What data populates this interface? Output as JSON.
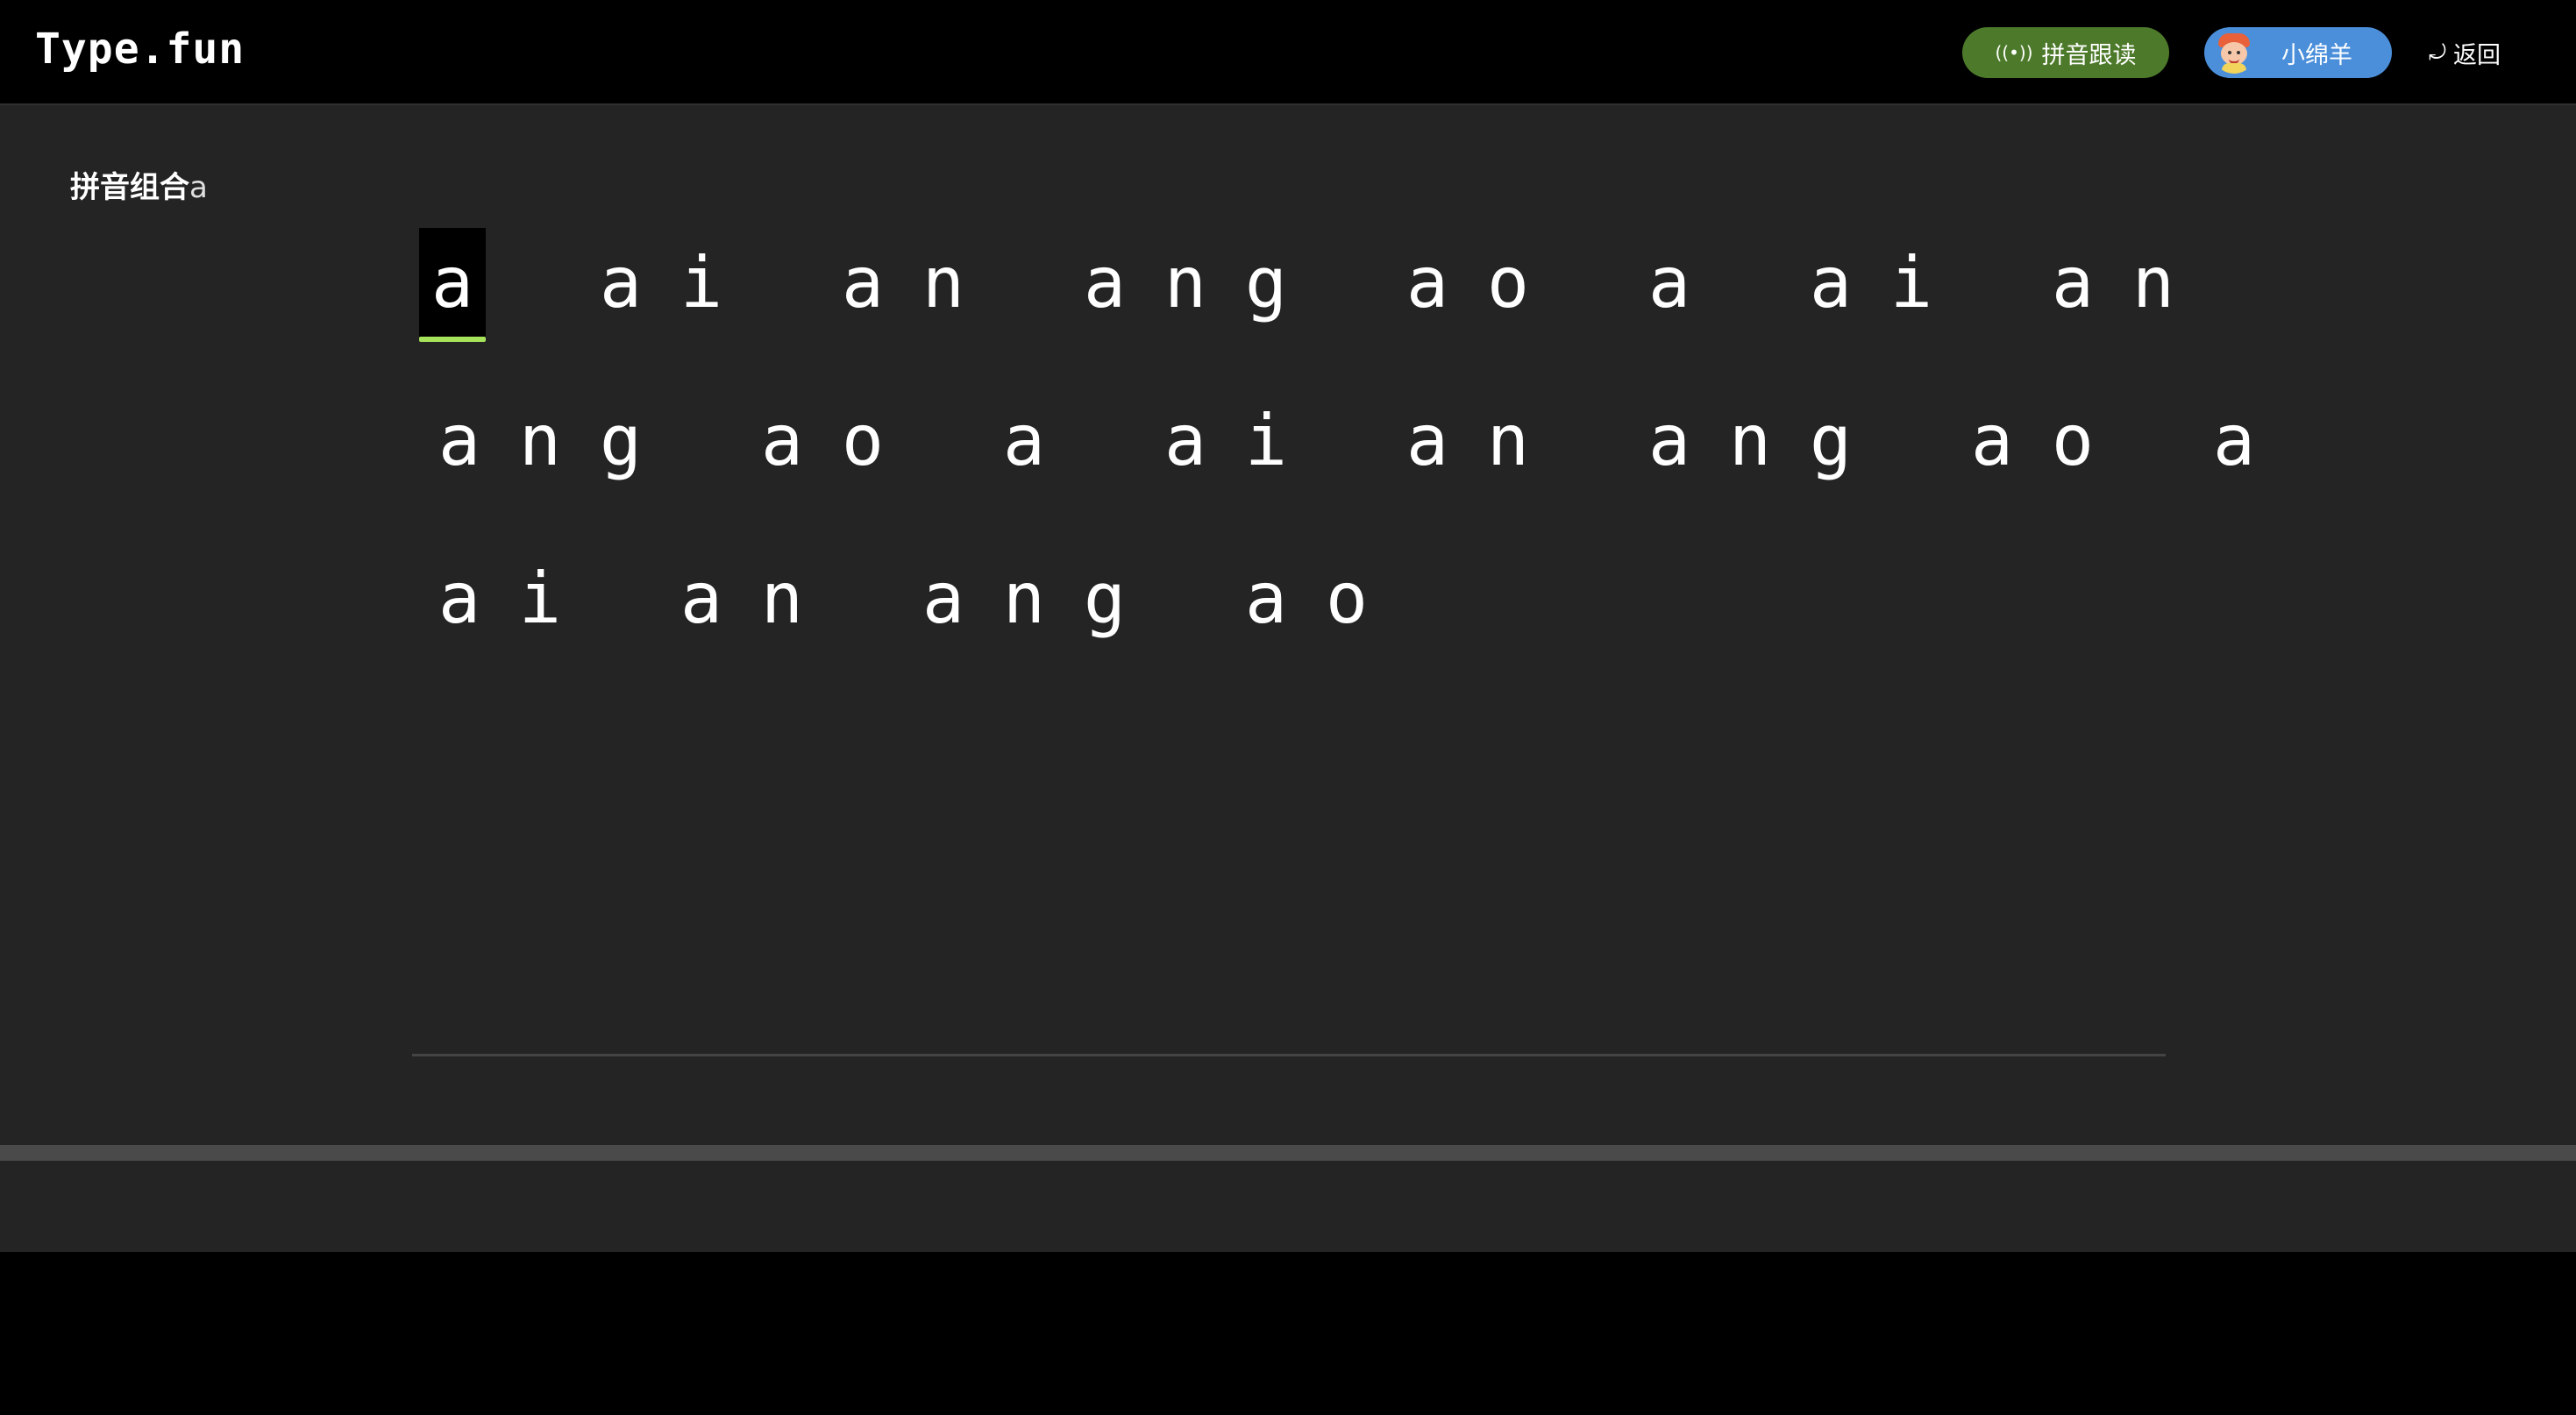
{
  "app": {
    "logo": "Type.fun"
  },
  "header": {
    "follow_read": {
      "icon": "broadcast-icon",
      "label": "拼音跟读"
    },
    "user": {
      "name": "小绵羊",
      "avatar": "cartoon-avatar"
    },
    "back": {
      "icon": "return-icon",
      "label": "返回"
    }
  },
  "lesson": {
    "title_bold": "拼音组合",
    "title_suffix": "a"
  },
  "typing": {
    "lines": [
      [
        "a",
        "ai",
        "an",
        "ang",
        "ao",
        "a",
        "ai",
        "an"
      ],
      [
        "ang",
        "ao",
        "a",
        "ai",
        "an",
        "ang",
        "ao",
        "a"
      ],
      [
        "ai",
        "an",
        "ang",
        "ao"
      ]
    ],
    "cursor": {
      "line": 0,
      "word": 0,
      "char": 0
    }
  },
  "colors": {
    "background": "#242424",
    "topbar": "#000000",
    "follow_button": "#4d7a2a",
    "user_button": "#4b8fdb",
    "cursor_underline": "#a6e35a"
  }
}
